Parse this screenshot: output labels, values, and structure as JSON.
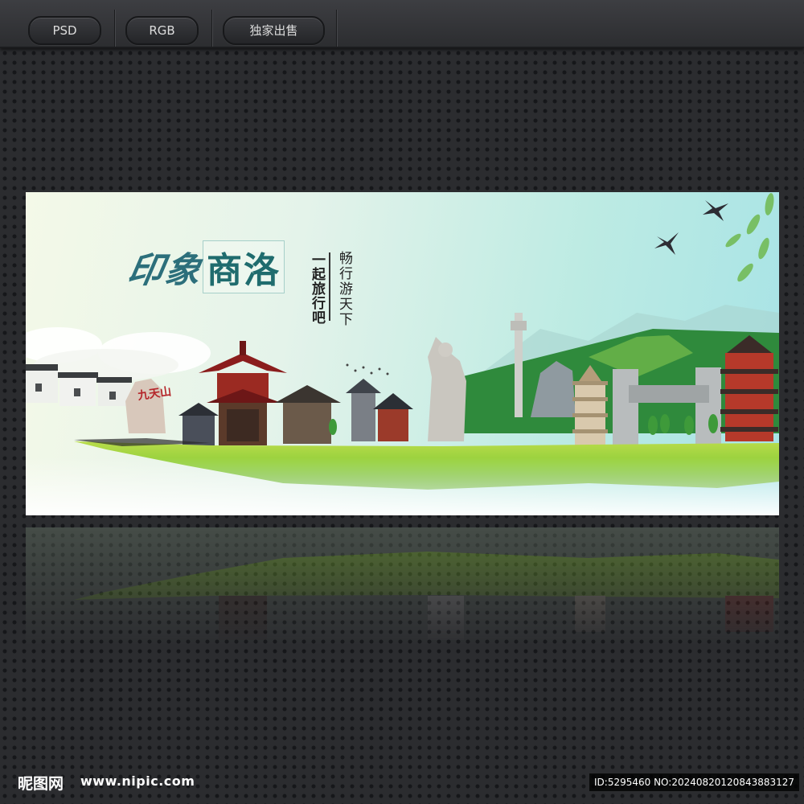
{
  "toolbar": {
    "buttons": [
      {
        "label": "PSD"
      },
      {
        "label": "RGB"
      },
      {
        "label": "独家出售"
      }
    ]
  },
  "banner": {
    "title_part1": "印象",
    "title_part2": "商洛",
    "slogan_vertical_1": "一起旅行吧",
    "slogan_vertical_2": "畅行游天下",
    "rock_inscription": "九天山",
    "colors": {
      "sky": "#bdebe3",
      "grass": "#8fce3a",
      "title": "#1f6c6e"
    }
  },
  "footer": {
    "site_logo": "昵图网",
    "site_url": "www.nipic.com",
    "image_id": "ID:5295460 NO:20240820120843883127"
  }
}
